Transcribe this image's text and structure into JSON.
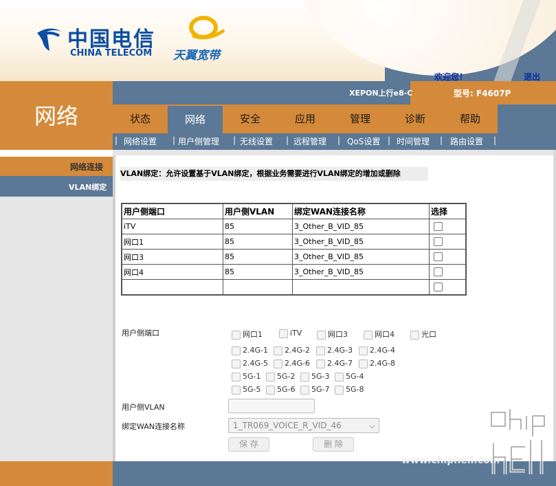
{
  "header": {
    "brand_cn": "中国电信",
    "brand_en": "CHINA TELECOM",
    "sub_brand": "天翼宽带",
    "welcome": "欢迎您！",
    "logout": "退出"
  },
  "info": {
    "access": "XEPON上行e8-C",
    "model": "型号: F4607P"
  },
  "section_title": "网络",
  "tabs": [
    {
      "label": "状态"
    },
    {
      "label": "网络"
    },
    {
      "label": "安全"
    },
    {
      "label": "应用"
    },
    {
      "label": "管理"
    },
    {
      "label": "诊断"
    },
    {
      "label": "帮助"
    }
  ],
  "active_tab": "网络",
  "subnav": [
    "网络设置",
    "用户侧管理",
    "无线设置",
    "远程管理",
    "QoS设置",
    "时间管理",
    "路由设置"
  ],
  "sidebar": {
    "items": [
      {
        "label": "网络连接"
      },
      {
        "label": "VLAN绑定"
      }
    ]
  },
  "description": "VLAN绑定：允许设置基于VLAN绑定，根据业务需要进行VLAN绑定的增加或删除",
  "table": {
    "headers": [
      "用户侧端口",
      "用户侧VLAN",
      "绑定WAN连接名称",
      "选择"
    ],
    "rows": [
      {
        "port": "iTV",
        "vlan": "85",
        "wan": "3_Other_B_VID_85"
      },
      {
        "port": "网口1",
        "vlan": "85",
        "wan": "3_Other_B_VID_85"
      },
      {
        "port": "网口3",
        "vlan": "85",
        "wan": "3_Other_B_VID_85"
      },
      {
        "port": "网口4",
        "vlan": "85",
        "wan": "3_Other_B_VID_85"
      },
      {
        "port": "",
        "vlan": "",
        "wan": ""
      }
    ]
  },
  "form": {
    "port_label": "用户侧端口",
    "vlan_label": "用户侧VLAN",
    "wan_label": "绑定WAN连接名称",
    "vlan_value": "",
    "wan_selected": "1_TR069_VOICE_R_VID_46",
    "ports_row1": [
      "网口1",
      "iTV",
      "网口3",
      "网口4",
      "光口"
    ],
    "ports_24g_a": [
      "2.4G-1",
      "2.4G-2",
      "2.4G-3",
      "2.4G-4"
    ],
    "ports_24g_b": [
      "2.4G-5",
      "2.4G-6",
      "2.4G-7",
      "2.4G-8"
    ],
    "ports_5g_a": [
      "5G-1",
      "5G-2",
      "5G-3",
      "5G-4"
    ],
    "ports_5g_b": [
      "5G-5",
      "5G-6",
      "5G-7",
      "5G-8"
    ],
    "save_label": "保 存",
    "delete_label": "删 除"
  },
  "watermark": {
    "url": "www.chiphell.com"
  },
  "colors": {
    "orange": "#d48a3a",
    "steel_blue": "#5b7896",
    "brand_blue": "#0b4ea2"
  }
}
